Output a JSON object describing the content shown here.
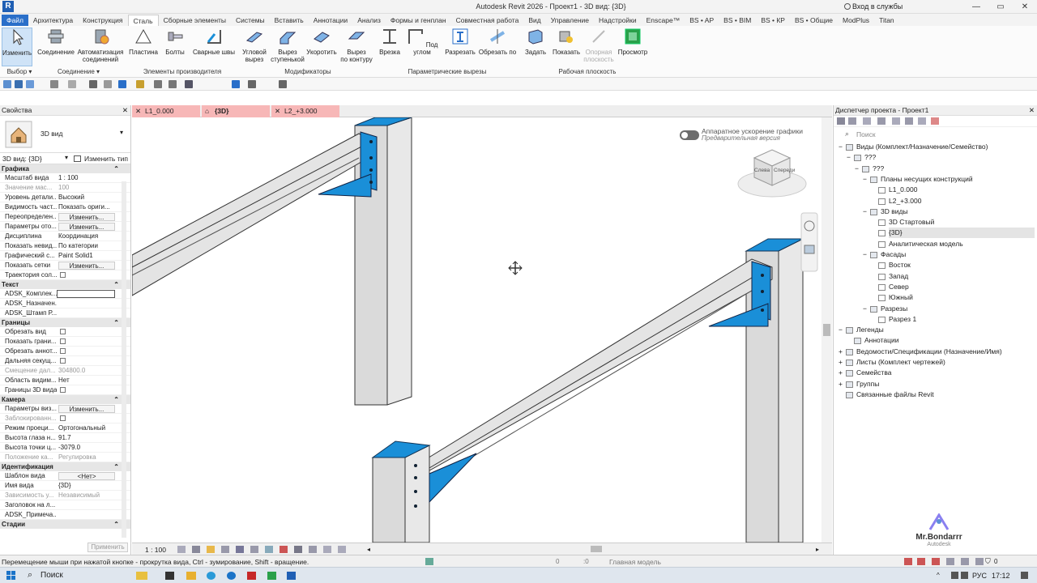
{
  "window": {
    "title": "Autodesk Revit 2026 - Проект1 - 3D вид: {3D}",
    "app_logo": "R",
    "login": "Вход в службы",
    "minimize": "—",
    "restore": "▭",
    "close": "✕"
  },
  "ribbon_tabs": [
    "Файл",
    "Архитектура",
    "Конструкция",
    "Сталь",
    "Сборные элементы",
    "Системы",
    "Вставить",
    "Аннотации",
    "Анализ",
    "Формы и генплан",
    "Совместная работа",
    "Вид",
    "Управление",
    "Надстройки",
    "Enscape™",
    "BS • AP",
    "BS • BIM",
    "BS • КР",
    "BS • Общие",
    "ModPlus",
    "Titan"
  ],
  "ribbon": {
    "modify": "Изменить",
    "connection": "Соединение",
    "auto_connection_1": "Автоматизация",
    "auto_connection_2": "соединений",
    "plate": "Пластина",
    "bolts": "Болты",
    "welds": "Сварные швы",
    "corner_cut_1": "Угловой",
    "corner_cut_2": "вырез",
    "step_cut_1": "Вырез",
    "step_cut_2": "ступенькой",
    "shorten": "Укоротить",
    "contour_cut_1": "Вырез",
    "contour_cut_2": "по контуру",
    "notch": "Врезка",
    "angle_cut": "Под углом",
    "split": "Разрезать",
    "cut_by": "Обрезать по",
    "set": "Задать",
    "show": "Показать",
    "ref_plane_1": "Опорная",
    "ref_plane_2": "плоскость",
    "viewer": "Просмотр",
    "panel_select": "Выбор",
    "panel_connection": "Соединение",
    "panel_fab": "Элементы производителя",
    "panel_modifiers": "Модификаторы",
    "panel_param_cuts": "Параметрические вырезы",
    "panel_workplane": "Рабочая плоскость"
  },
  "properties": {
    "header": "Свойства",
    "type_name": "3D вид",
    "instance": "3D вид: {3D}",
    "edit_type": "Изменить тип",
    "apply": "Применить",
    "groups": [
      {
        "title": "Графика",
        "rows": [
          {
            "k": "Масштаб вида",
            "v": "1 : 100"
          },
          {
            "k": "Значение мас...",
            "v": "100",
            "dis": true
          },
          {
            "k": "Уровень детали...",
            "v": "Высокий"
          },
          {
            "k": "Видимость част...",
            "v": "Показать ориги..."
          },
          {
            "k": "Переопределен...",
            "v": "Изменить...",
            "btn": true
          },
          {
            "k": "Параметры ото...",
            "v": "Изменить...",
            "btn": true
          },
          {
            "k": "Дисциплина",
            "v": "Координация"
          },
          {
            "k": "Показать невид...",
            "v": "По категории"
          },
          {
            "k": "Графический с...",
            "v": "Paint Solid1"
          },
          {
            "k": "Показать сетки",
            "v": "Изменить...",
            "btn": true
          },
          {
            "k": "Траектория сол...",
            "cb": true
          }
        ]
      },
      {
        "title": "Текст",
        "rows": [
          {
            "k": "ADSK_Комплек...",
            "v": "",
            "input": true
          },
          {
            "k": "ADSK_Назначен...",
            "v": ""
          },
          {
            "k": "ADSK_Штамп Р...",
            "v": ""
          }
        ]
      },
      {
        "title": "Границы",
        "rows": [
          {
            "k": "Обрезать вид",
            "cb": true
          },
          {
            "k": "Показать грани...",
            "cb": true
          },
          {
            "k": "Обрезать аннот...",
            "cb": true
          },
          {
            "k": "Дальняя секущ...",
            "cb": true
          },
          {
            "k": "Смещение дал...",
            "v": "304800.0",
            "dis": true
          },
          {
            "k": "Область видим...",
            "v": "Нет"
          },
          {
            "k": "Границы 3D вида",
            "cb": true
          }
        ]
      },
      {
        "title": "Камера",
        "rows": [
          {
            "k": "Параметры виз...",
            "v": "Изменить...",
            "btn": true
          },
          {
            "k": "Заблокированн...",
            "cb": true,
            "dis": true
          },
          {
            "k": "Режим проеци...",
            "v": "Ортогональный"
          },
          {
            "k": "Высота глаза н...",
            "v": "91.7"
          },
          {
            "k": "Высота точки ц...",
            "v": "-3079.0"
          },
          {
            "k": "Положение ка...",
            "v": "Регулировка",
            "dis": true
          }
        ]
      },
      {
        "title": "Идентификация",
        "rows": [
          {
            "k": "Шаблон вида",
            "v": "<Нет>",
            "btn": true
          },
          {
            "k": "Имя вида",
            "v": "{3D}"
          },
          {
            "k": "Зависимость у...",
            "v": "Независимый",
            "dis": true
          },
          {
            "k": "Заголовок на л...",
            "v": ""
          },
          {
            "k": "ADSK_Примеча...",
            "v": ""
          }
        ]
      },
      {
        "title": "Стадии",
        "rows": []
      }
    ]
  },
  "view_tabs": [
    {
      "label": "L1_0.000"
    },
    {
      "label": "{3D}"
    },
    {
      "label": "L2_+3.000"
    }
  ],
  "viewport": {
    "hw_accel": "Аппаратное ускорение графики",
    "preview": "Предварительная версия",
    "cube_left": "Слева",
    "cube_front": "Спереди"
  },
  "view_bar": {
    "scale": "1 : 100"
  },
  "browser": {
    "header": "Диспетчер проекта - Проект1",
    "search_placeholder": "Поиск",
    "tree": [
      {
        "t": "Виды (Комплект/Назначение/Семейство)",
        "lvl": 0,
        "exp": "−"
      },
      {
        "t": "???",
        "lvl": 1,
        "exp": "−"
      },
      {
        "t": "???",
        "lvl": 2,
        "exp": "−"
      },
      {
        "t": "Планы несущих конструкций",
        "lvl": 3,
        "exp": "−"
      },
      {
        "t": "L1_0.000",
        "lvl": 4
      },
      {
        "t": "L2_+3.000",
        "lvl": 4
      },
      {
        "t": "3D виды",
        "lvl": 3,
        "exp": "−"
      },
      {
        "t": "3D Стартовый",
        "lvl": 4
      },
      {
        "t": "{3D}",
        "lvl": 4,
        "sel": true
      },
      {
        "t": "Аналитическая модель",
        "lvl": 4
      },
      {
        "t": "Фасады",
        "lvl": 3,
        "exp": "−"
      },
      {
        "t": "Восток",
        "lvl": 4
      },
      {
        "t": "Запад",
        "lvl": 4
      },
      {
        "t": "Север",
        "lvl": 4
      },
      {
        "t": "Южный",
        "lvl": 4
      },
      {
        "t": "Разрезы",
        "lvl": 3,
        "exp": "−"
      },
      {
        "t": "Разрез 1",
        "lvl": 4
      },
      {
        "t": "Легенды",
        "lvl": 0,
        "exp": "−"
      },
      {
        "t": "Аннотации",
        "lvl": 1
      },
      {
        "t": "Ведомости/Спецификации (Назначение/Имя)",
        "lvl": 0,
        "exp": "+"
      },
      {
        "t": "Листы (Комплект чертежей)",
        "lvl": 0,
        "exp": "+"
      },
      {
        "t": "Семейства",
        "lvl": 0,
        "exp": "+"
      },
      {
        "t": "Группы",
        "lvl": 0,
        "exp": "+"
      },
      {
        "t": "Связанные файлы Revit",
        "lvl": 0
      }
    ]
  },
  "watermark": {
    "name": "Mr.Bondarrr",
    "sub": "Autodesk"
  },
  "status": {
    "hint": "Перемещение мыши при нажатой кнопке - прокрутка вида, Ctrl - зумирование, Shift - вращение.",
    "count0a": "0",
    "count0b": ":0",
    "model": "Главная модель",
    "filter": "0"
  },
  "taskbar": {
    "search": "Поиск",
    "lang": "РУС",
    "time": "17:12"
  },
  "colors": {
    "steel_blue": "#1a8fd8",
    "accent": "#2a6fc9",
    "tab_pink": "#f7b7b7"
  }
}
